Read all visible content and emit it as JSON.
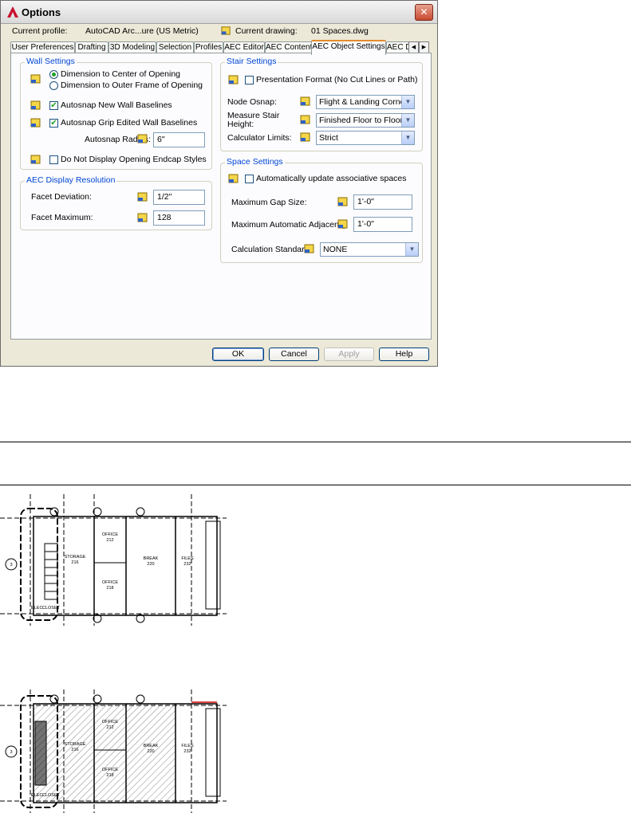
{
  "window": {
    "title": "Options",
    "current_profile_label": "Current profile:",
    "current_profile_value": "AutoCAD Arc...ure (US Metric)",
    "current_drawing_label": "Current drawing:",
    "current_drawing_value": "01 Spaces.dwg"
  },
  "tabs": [
    {
      "label": "User Preferences"
    },
    {
      "label": "Drafting"
    },
    {
      "label": "3D Modeling"
    },
    {
      "label": "Selection"
    },
    {
      "label": "Profiles"
    },
    {
      "label": "AEC Editor"
    },
    {
      "label": "AEC Content"
    },
    {
      "label": "AEC Object Settings",
      "active": true
    },
    {
      "label": "AEC D"
    }
  ],
  "wall_settings": {
    "title": "Wall Settings",
    "radio_center": "Dimension to Center of Opening",
    "radio_outer": "Dimension to Outer Frame of Opening",
    "autosnap_new": "Autosnap New Wall Baselines",
    "autosnap_grip": "Autosnap Grip Edited Wall Baselines",
    "autosnap_radius_label": "Autosnap Radius:",
    "autosnap_radius_value": "6\"",
    "no_endcap": "Do Not Display Opening Endcap Styles"
  },
  "display_resolution": {
    "title": "AEC Display Resolution",
    "facet_deviation_label": "Facet Deviation:",
    "facet_deviation_value": "1/2\"",
    "facet_maximum_label": "Facet Maximum:",
    "facet_maximum_value": "128"
  },
  "stair_settings": {
    "title": "Stair Settings",
    "presentation_format": "Presentation Format (No Cut Lines or Path)",
    "node_osnap_label": "Node Osnap:",
    "node_osnap_value": "Flight & Landing Corners",
    "measure_height_label": "Measure Stair Height:",
    "measure_height_value": "Finished Floor to Floor",
    "calculator_limits_label": "Calculator Limits:",
    "calculator_limits_value": "Strict"
  },
  "space_settings": {
    "title": "Space Settings",
    "auto_update": "Automatically update associative spaces",
    "max_gap_label": "Maximum Gap Size:",
    "max_gap_value": "1'-0\"",
    "max_adjacency_label": "Maximum Automatic Adjacency",
    "max_adjacency_value": "1'-0\"",
    "calc_standard_label": "Calculation Standard:",
    "calc_standard_value": "NONE"
  },
  "buttons": {
    "ok": "OK",
    "cancel": "Cancel",
    "apply": "Apply",
    "help": "Help"
  },
  "floor_plan": {
    "rooms": {
      "storage": "STORAGE",
      "storage_no": "216",
      "office_a": "OFFICE",
      "office_a_no": "212",
      "office_b": "OFFICE",
      "office_b_no": "218",
      "break": "BREAK",
      "break_no": "220",
      "files": "FILES",
      "files_no": "232",
      "elec": "ELEC.",
      "closet": "CLOSET"
    },
    "grid_bubble": "3"
  },
  "colors": {
    "window_bg": "#ece9d8",
    "group_title": "#0046d5",
    "active_tab_accent": "#e68b2c",
    "check_mark": "#21a121"
  }
}
